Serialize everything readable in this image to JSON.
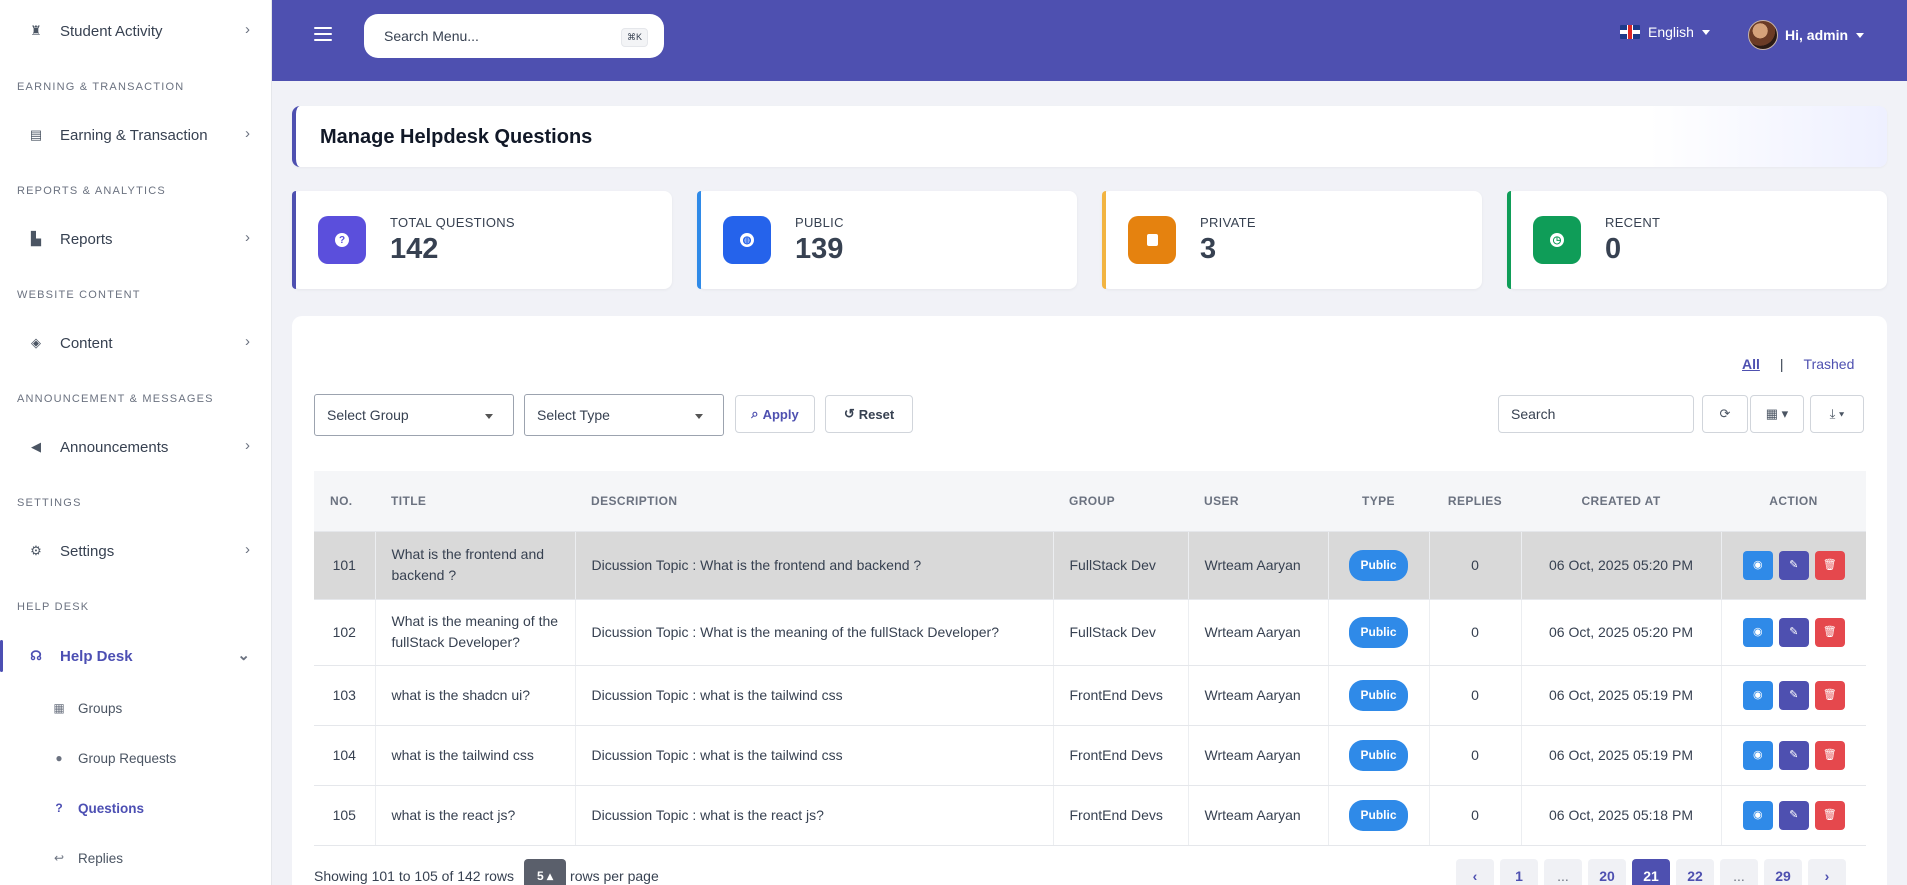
{
  "sidebar": {
    "items": [
      {
        "label": "Student Activity"
      },
      {
        "label": "Earning & Transaction"
      },
      {
        "label": "Reports"
      },
      {
        "label": "Content"
      },
      {
        "label": "Announcements"
      },
      {
        "label": "Settings"
      },
      {
        "label": "Help Desk"
      }
    ],
    "sections": [
      "EARNING & TRANSACTION",
      "REPORTS & ANALYTICS",
      "WEBSITE CONTENT",
      "ANNOUNCEMENT & MESSAGES",
      "SETTINGS",
      "HELP DESK"
    ],
    "subitems": [
      {
        "label": "Groups"
      },
      {
        "label": "Group Requests"
      },
      {
        "label": "Questions"
      },
      {
        "label": "Replies"
      }
    ]
  },
  "topbar": {
    "search_placeholder": "Search Menu...",
    "shortcut": "⌘K",
    "language": "English",
    "user_greeting": "Hi, admin"
  },
  "page": {
    "title": "Manage Helpdesk Questions"
  },
  "stats": [
    {
      "label": "TOTAL QUESTIONS",
      "value": "142",
      "color": "#5b4fdc"
    },
    {
      "label": "PUBLIC",
      "value": "139",
      "color": "#2563eb"
    },
    {
      "label": "PRIVATE",
      "value": "3",
      "color": "#e5820f"
    },
    {
      "label": "RECENT",
      "value": "0",
      "color": "#0f9d58"
    }
  ],
  "filters": {
    "link_all": "All",
    "link_trashed": "Trashed",
    "select_group": "Select Group",
    "select_type": "Select Type",
    "apply": "Apply",
    "reset": "Reset",
    "search_placeholder": "Search"
  },
  "table": {
    "headers": [
      "NO.",
      "TITLE",
      "DESCRIPTION",
      "GROUP",
      "USER",
      "TYPE",
      "REPLIES",
      "CREATED AT",
      "ACTION"
    ],
    "rows": [
      {
        "no": "101",
        "title": "What is the frontend and backend ?",
        "description": "Dicussion Topic : What is the frontend and backend ?",
        "group": "FullStack Dev",
        "user": "Wrteam Aaryan",
        "type": "Public",
        "replies": "0",
        "created": "06 Oct, 2025 05:20 PM"
      },
      {
        "no": "102",
        "title": "What is the meaning of the fullStack Developer?",
        "description": "Dicussion Topic : What is the meaning of the fullStack Developer?",
        "group": "FullStack Dev",
        "user": "Wrteam Aaryan",
        "type": "Public",
        "replies": "0",
        "created": "06 Oct, 2025 05:20 PM"
      },
      {
        "no": "103",
        "title": "what is the shadcn ui?",
        "description": "Dicussion Topic : what is the tailwind css",
        "group": "FrontEnd Devs",
        "user": "Wrteam Aaryan",
        "type": "Public",
        "replies": "0",
        "created": "06 Oct, 2025 05:19 PM"
      },
      {
        "no": "104",
        "title": "what is the tailwind css",
        "description": "Dicussion Topic : what is the tailwind css",
        "group": "FrontEnd Devs",
        "user": "Wrteam Aaryan",
        "type": "Public",
        "replies": "0",
        "created": "06 Oct, 2025 05:19 PM"
      },
      {
        "no": "105",
        "title": "what is the react js?",
        "description": "Dicussion Topic : what is the react js?",
        "group": "FrontEnd Devs",
        "user": "Wrteam Aaryan",
        "type": "Public",
        "replies": "0",
        "created": "06 Oct, 2025 05:18 PM"
      }
    ]
  },
  "footer": {
    "showing": "Showing 101 to 105 of 142 rows",
    "rows_per_page_value": "5",
    "rows_per_page_label": "rows per page",
    "pages": [
      "‹",
      "1",
      "...",
      "20",
      "21",
      "22",
      "...",
      "29",
      "›"
    ],
    "current_page": "21"
  }
}
